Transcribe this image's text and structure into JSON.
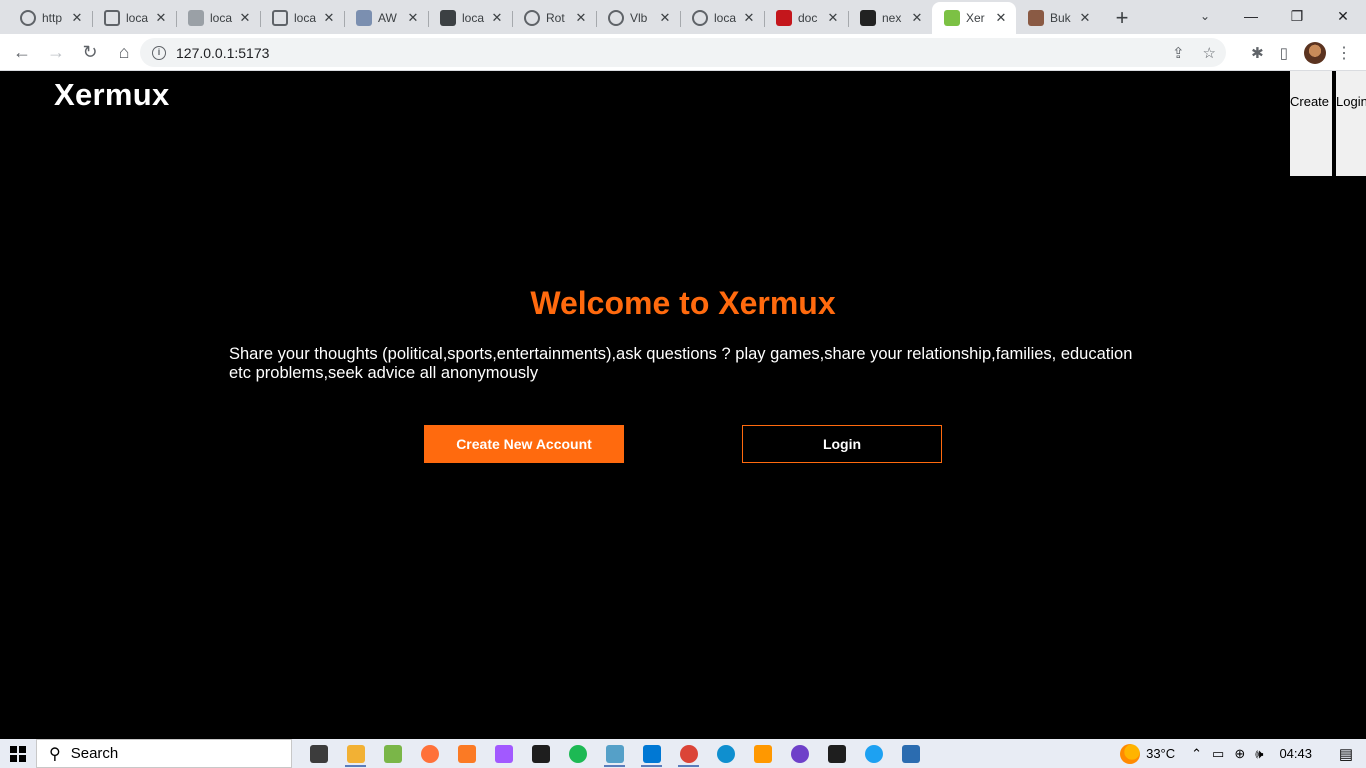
{
  "browser": {
    "tabs": [
      {
        "title": "http",
        "favicon": "globe-icon",
        "color": "#5f6368",
        "active": false
      },
      {
        "title": "loca",
        "favicon": "box-icon",
        "color": "#5f6368",
        "active": false
      },
      {
        "title": "loca",
        "favicon": "triangle-logo-icon",
        "color": "#9aa0a6",
        "active": false
      },
      {
        "title": "loca",
        "favicon": "box-icon",
        "color": "#5f6368",
        "active": false
      },
      {
        "title": "AW",
        "favicon": "grid-icon",
        "color": "#7b8fb0",
        "active": false
      },
      {
        "title": "loca",
        "favicon": "doc-icon",
        "color": "#3c4043",
        "active": false
      },
      {
        "title": "Rot",
        "favicon": "globe-icon",
        "color": "#5f6368",
        "active": false
      },
      {
        "title": "Vlb",
        "favicon": "globe-icon",
        "color": "#5f6368",
        "active": false
      },
      {
        "title": "loca",
        "favicon": "globe-icon",
        "color": "#5f6368",
        "active": false
      },
      {
        "title": "doc",
        "favicon": "red-logo-icon",
        "color": "#c4161c",
        "active": false
      },
      {
        "title": "nex",
        "favicon": "next-logo-icon",
        "color": "#222222",
        "active": false
      },
      {
        "title": "Xer",
        "favicon": "xermux-logo-icon",
        "color": "#7cc144",
        "active": true
      },
      {
        "title": "Buk",
        "favicon": "avatar-icon",
        "color": "#8a5a44",
        "active": false
      }
    ],
    "close_glyph": "✕",
    "new_tab_glyph": "+",
    "tab_search_glyph": "⌄",
    "window_controls": {
      "minimize": "—",
      "restore": "❐",
      "close": "✕"
    },
    "nav": {
      "back": "←",
      "forward": "→",
      "reload": "↻",
      "home": "⌂"
    },
    "info_glyph": "i",
    "url": "127.0.0.1:5173",
    "omnibox_icons": {
      "share": "⇪",
      "bookmark": "☆"
    },
    "toolbar_icons": {
      "extensions": "✱",
      "side_panel": "▯",
      "menu": "⋮"
    }
  },
  "page": {
    "brand": "Xermux",
    "nav_create": "Create",
    "nav_login": "Login",
    "hero_title": "Welcome to Xermux",
    "hero_text": "Share your thoughts (political,sports,entertainments),ask questions ? play games,share your relationship,families, education etc problems,seek advice all anonymously",
    "create_button": "Create New Account",
    "login_button": "Login",
    "accent_color": "#ff6a0e"
  },
  "taskbar": {
    "search_glyph": "⚲",
    "search_placeholder": "Search",
    "apps": [
      {
        "name": "task-view-icon",
        "color": "#3c3c3c",
        "open": false
      },
      {
        "name": "file-explorer-icon",
        "color": "#f2b134",
        "open": true
      },
      {
        "name": "paint-icon",
        "color": "#7ab648",
        "open": false
      },
      {
        "name": "firefox-icon",
        "color": "#ff7139",
        "open": false
      },
      {
        "name": "xampp-icon",
        "color": "#fb7a24",
        "open": false
      },
      {
        "name": "figma-icon",
        "color": "#a259ff",
        "open": false
      },
      {
        "name": "store-icon",
        "color": "#1e1e1e",
        "open": false
      },
      {
        "name": "spotify-icon",
        "color": "#1db954",
        "open": false
      },
      {
        "name": "notepad-icon",
        "color": "#55a0c8",
        "open": true
      },
      {
        "name": "vscode-icon",
        "color": "#0078d4",
        "open": true
      },
      {
        "name": "chrome-icon",
        "color": "#db4437",
        "open": true
      },
      {
        "name": "edge-icon",
        "color": "#0f8fcf",
        "open": false
      },
      {
        "name": "sublime-icon",
        "color": "#ff9800",
        "open": false
      },
      {
        "name": "github-desktop-icon",
        "color": "#6e40c9",
        "open": false
      },
      {
        "name": "terminal-icon",
        "color": "#1e1e1e",
        "open": false
      },
      {
        "name": "twitter-icon",
        "color": "#1da1f2",
        "open": false
      },
      {
        "name": "app-icon",
        "color": "#2b6cb0",
        "open": false
      }
    ],
    "weather_temp": "33°C",
    "tray": {
      "chevron": "⌃",
      "battery": "▭",
      "network": "⊕",
      "volume": "🕪"
    },
    "time": "04:43",
    "notification_glyph": "▤"
  }
}
